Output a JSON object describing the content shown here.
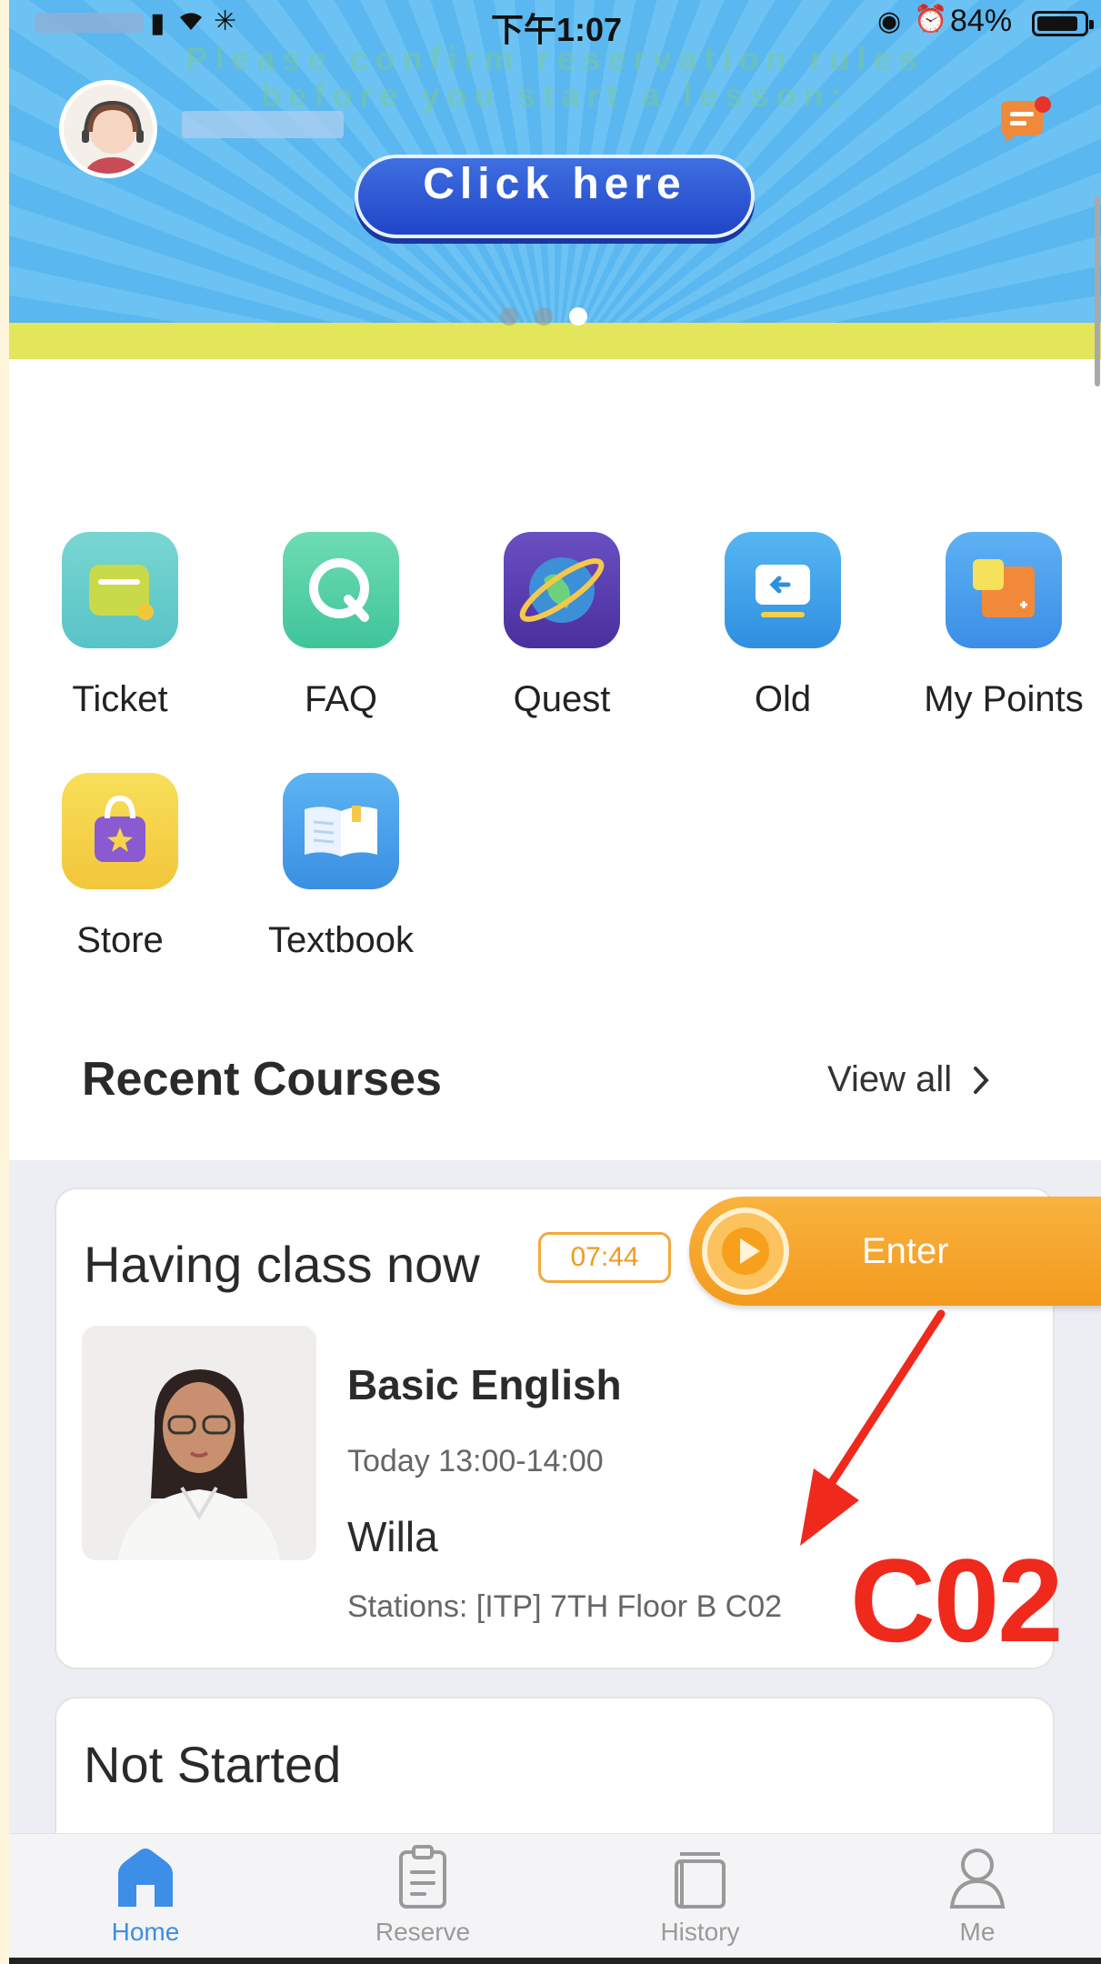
{
  "status_bar": {
    "time": "下午1:07",
    "battery": "84%"
  },
  "banner": {
    "faded_line1": "Please confirm reservation rules",
    "faded_line2": "before you start a lesson:",
    "cta_label": "Click here",
    "slide_count": 3,
    "active_slide": 3
  },
  "quick_actions": [
    {
      "label": "Ticket",
      "icon": "ticket-icon"
    },
    {
      "label": "FAQ",
      "icon": "faq-icon"
    },
    {
      "label": "Quest",
      "icon": "quest-planet-icon"
    },
    {
      "label": "Old",
      "icon": "old-screen-icon"
    },
    {
      "label": "My Points",
      "icon": "points-card-icon"
    },
    {
      "label": "Store",
      "icon": "store-bag-icon"
    },
    {
      "label": "Textbook",
      "icon": "textbook-icon"
    }
  ],
  "recent": {
    "title": "Recent Courses",
    "view_all": "View all"
  },
  "current_class": {
    "status": "Having class now",
    "timer": "07:44",
    "enter_label": "Enter",
    "course": "Basic English",
    "time": "Today 13:00-14:00",
    "teacher": "Willa",
    "stations": "Stations: [ITP] 7TH Floor B C02"
  },
  "next_section": {
    "title": "Not Started"
  },
  "annotation": {
    "label": "C02",
    "color": "#f0291d"
  },
  "tabs": [
    {
      "label": "Home",
      "icon": "home-icon",
      "active": true
    },
    {
      "label": "Reserve",
      "icon": "clipboard-icon",
      "active": false
    },
    {
      "label": "History",
      "icon": "history-book-icon",
      "active": false
    },
    {
      "label": "Me",
      "icon": "person-icon",
      "active": false
    }
  ],
  "colors": {
    "accent": "#3d8ee6",
    "enter": "#f5a529",
    "timer": "#ef9b22"
  }
}
